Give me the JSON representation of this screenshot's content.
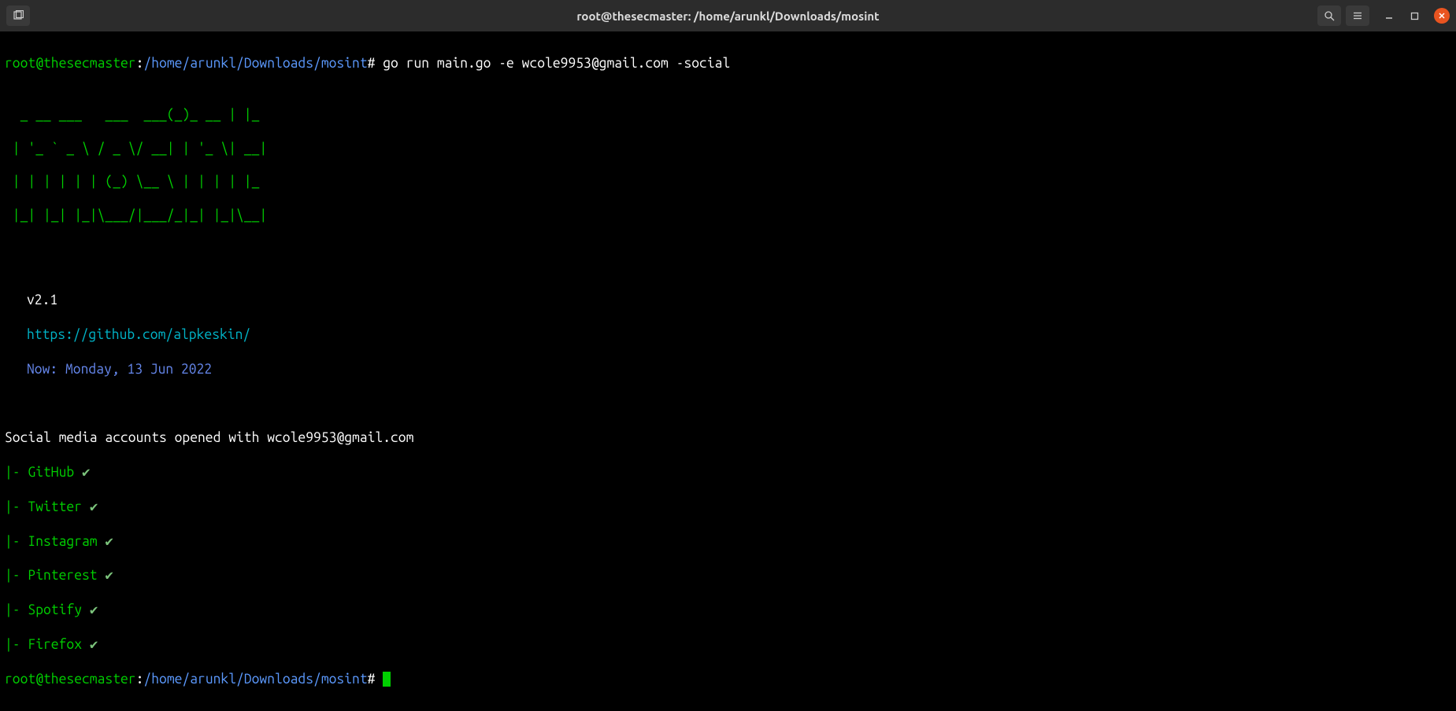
{
  "titlebar": {
    "title": "root@thesecmaster: /home/arunkl/Downloads/mosint"
  },
  "prompt": {
    "user_host": "root@thesecmaster",
    "colon": ":",
    "path": "/home/arunkl/Downloads/mosint",
    "hash": "#"
  },
  "command": "go run main.go -e wcole9953@gmail.com -social",
  "ascii": {
    "l1": "  _ __ ___   ___  ___(_)_ __ | |_ ",
    "l2": " | '_ ` _ \\ / _ \\/ __| | '_ \\| __|",
    "l3": " | | | | | | (_) \\__ \\ | | | | |_ ",
    "l4": " |_| |_| |_|\\___/|___/_|_| |_|\\__|"
  },
  "version": "v2.1",
  "url": "https://github.com/alpkeskin/",
  "now": "Now: Monday, 13 Jun 2022",
  "social": {
    "prefix": "Social media accounts opened with ",
    "email": "wcole9953@gmail.com",
    "items": [
      "GitHub",
      "Twitter",
      "Instagram",
      "Pinterest",
      "Spotify",
      "Firefox"
    ]
  }
}
